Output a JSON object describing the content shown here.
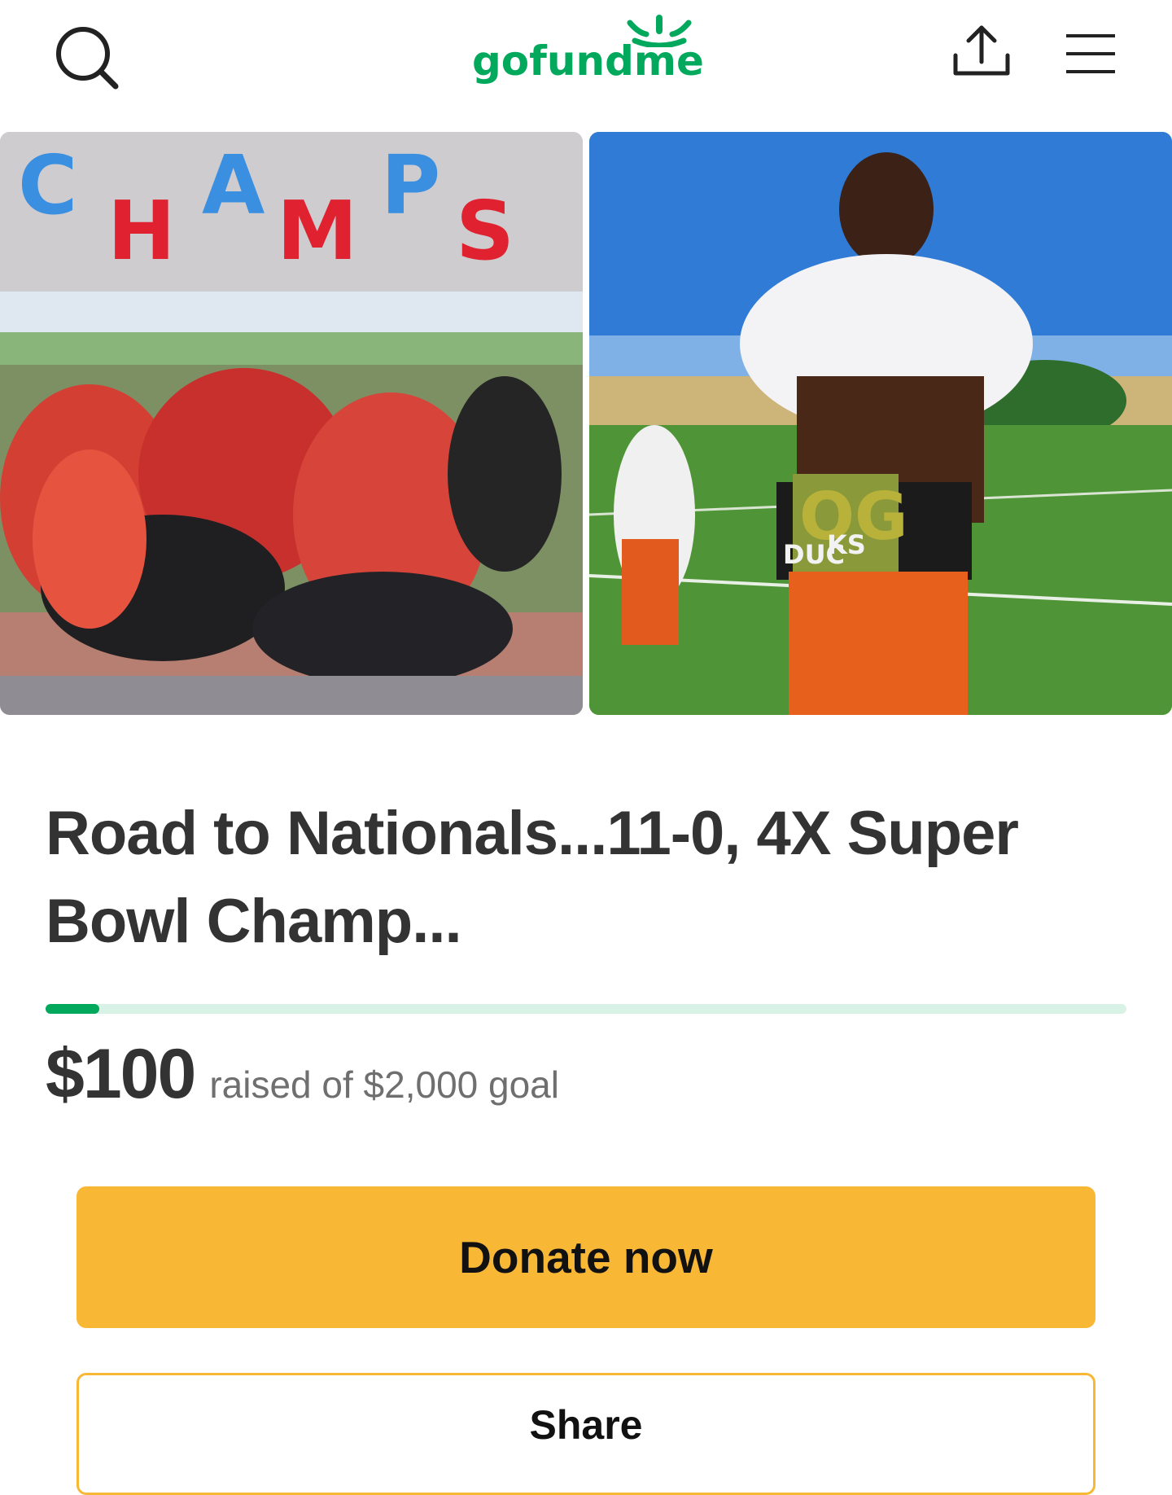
{
  "header": {
    "logo_text": "gofundme",
    "icons": [
      "search-icon",
      "share-upload-icon",
      "hamburger-menu-icon"
    ],
    "brand_color": "#02a95c"
  },
  "gallery": {
    "left_photo_text": [
      "C",
      "H",
      "A",
      "M",
      "P",
      "S"
    ],
    "right_photo_text": [
      "OG",
      "DUC",
      "KS"
    ]
  },
  "campaign": {
    "title": "Road to Nationals...11-0, 4X Super Bowl Champ...",
    "progress_fraction": 0.05,
    "raised_amount": "$100",
    "raised_text": "raised of $2,000 goal"
  },
  "actions": {
    "donate_label": "Donate now",
    "donate_color": "#f8b835",
    "share_label": "Share"
  }
}
